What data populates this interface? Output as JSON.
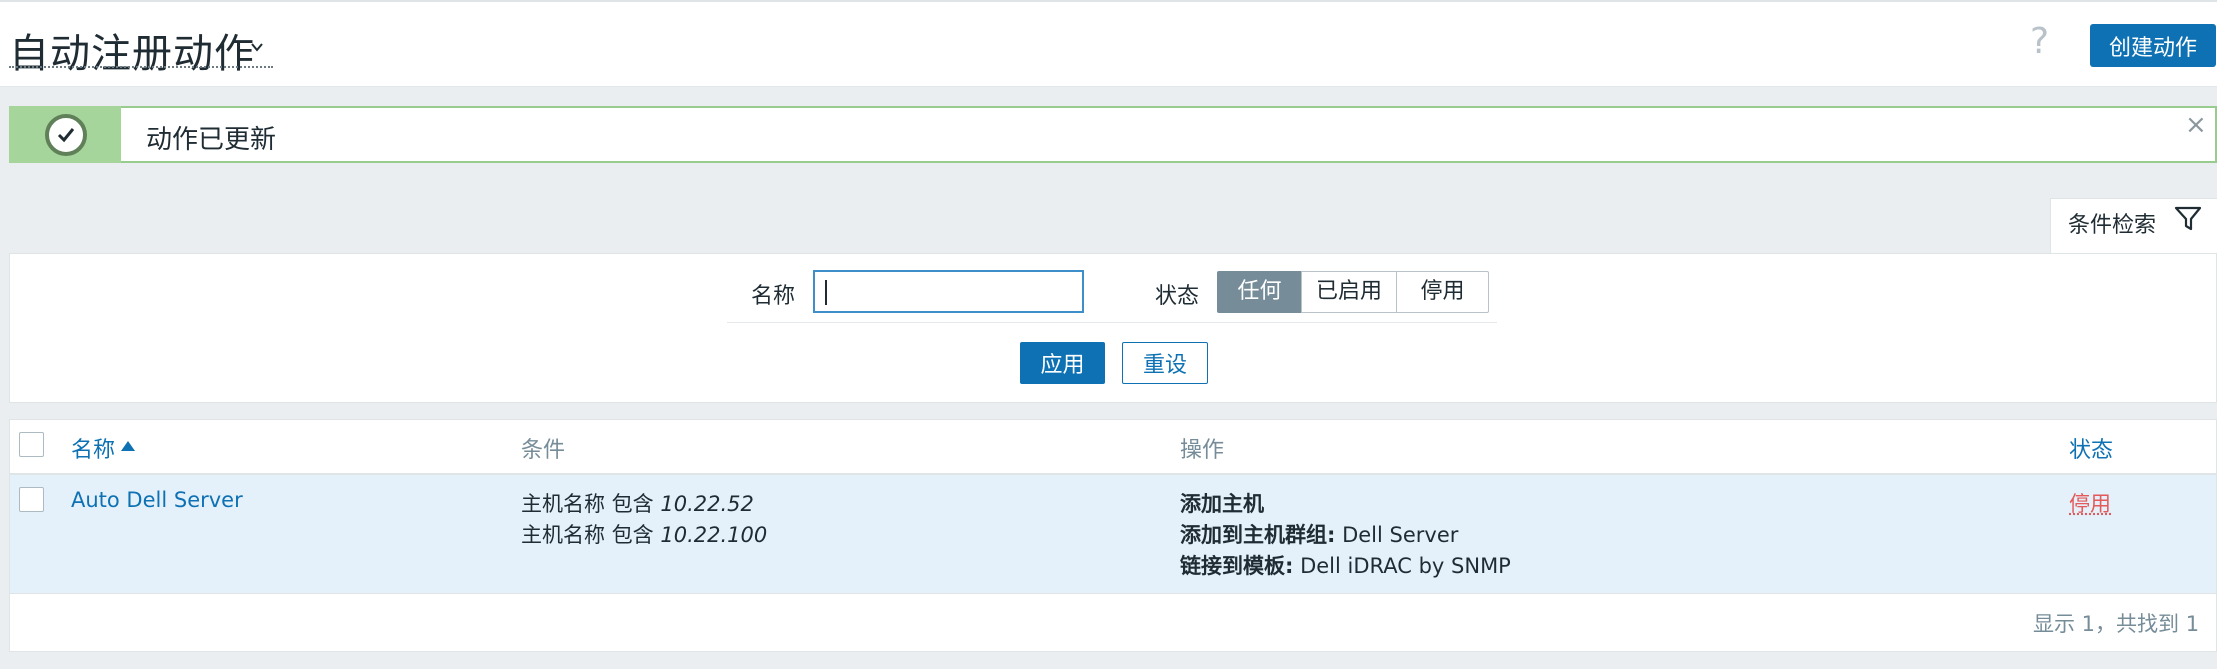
{
  "header": {
    "title": "自动注册动作",
    "help_icon": "?",
    "create_button": "创建动作"
  },
  "message": {
    "text": "动作已更新",
    "close_icon": "×",
    "colors": {
      "side": "#a6d59b",
      "border": "#97cc8e"
    }
  },
  "filter": {
    "tab_label": "条件检索",
    "name_label": "名称",
    "name_value": "",
    "status_label": "状态",
    "status_options": [
      "任何",
      "已启用",
      "停用"
    ],
    "status_selected": "任何",
    "apply_button": "应用",
    "reset_button": "重设"
  },
  "table": {
    "columns": [
      "名称",
      "条件",
      "操作",
      "状态"
    ],
    "sort_column": "名称",
    "rows": [
      {
        "name": "Auto Dell Server",
        "conditions": [
          {
            "prefix": "主机名称 包含 ",
            "value": "10.22.52"
          },
          {
            "prefix": "主机名称 包含 ",
            "value": "10.22.100"
          }
        ],
        "operations": [
          {
            "label": "添加主机",
            "value": ""
          },
          {
            "label": "添加到主机群组:",
            "value": " Dell Server"
          },
          {
            "label": "链接到模板:",
            "value": " Dell iDRAC by SNMP"
          }
        ],
        "status": "停用"
      }
    ],
    "footer": "显示 1，共找到 1"
  },
  "colors": {
    "accent": "#0e71b4",
    "status_disabled": "#e45959",
    "row_highlight": "#e5f1fa"
  }
}
